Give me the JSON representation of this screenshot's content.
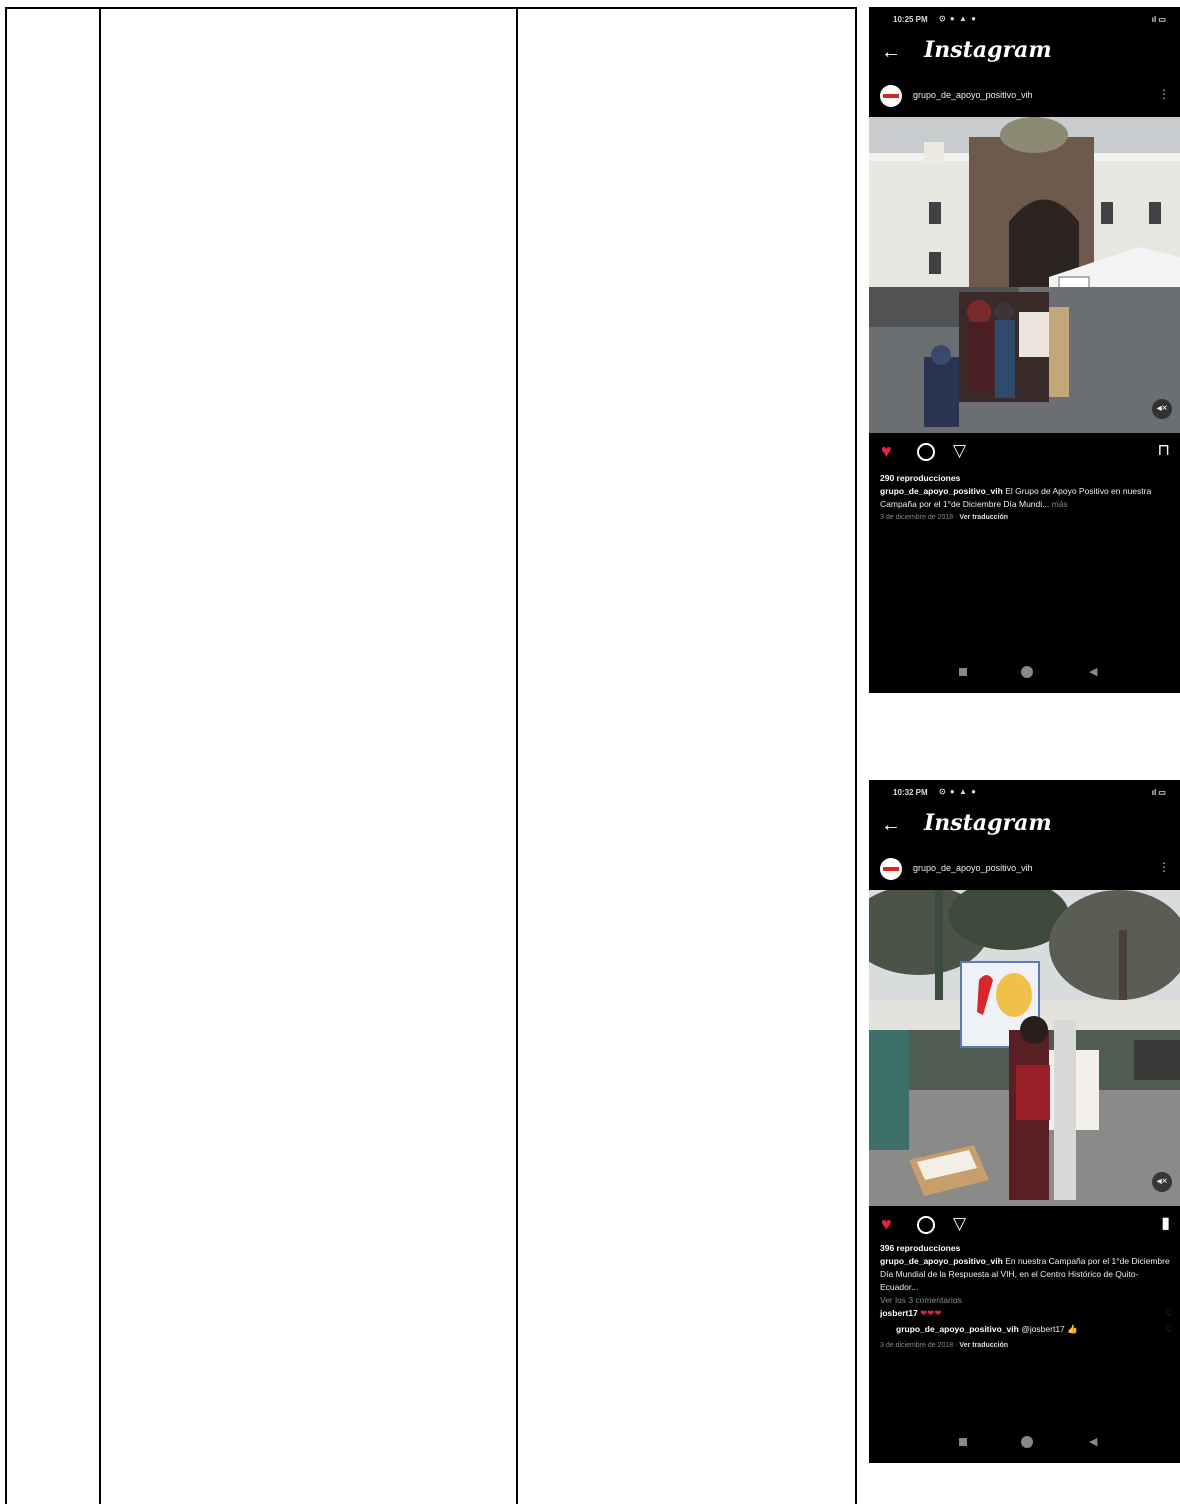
{
  "posts": [
    {
      "status": {
        "time": "10:25 PM",
        "icons": "⊙ ● ▲ ●",
        "right": "ıl ▭"
      },
      "app_title": "Instagram",
      "username": "grupo_de_apoyo_positivo_vih",
      "views": "290 reproducciones",
      "caption_user": "grupo_de_apoyo_positivo_vih",
      "caption_text": "El Grupo de Apoyo Positivo en nuestra Campaña por el 1°de Diciembre Día Mundi...",
      "more": "más",
      "date": "3 de diciembre de 2018",
      "translate": "Ver traducción"
    },
    {
      "status": {
        "time": "10:32 PM",
        "icons": "⊙ ● ▲ ●",
        "right": "ıl ▭"
      },
      "app_title": "Instagram",
      "username": "grupo_de_apoyo_positivo_vih",
      "views": "396 reproducciones",
      "caption_user": "grupo_de_apoyo_positivo_vih",
      "caption_text": "En nuestra Campaña por el 1°de Diciembre Día Mundial de la Respuesta al VIH, en el Centro Histórico de Quito-Ecuador...",
      "view_comments": "Ver los 3 comentarios",
      "comment1_user": "josbert17",
      "comment1_text": "❤❤❤",
      "comment2_user": "grupo_de_apoyo_positivo_vih",
      "comment2_text": "@josbert17 👍",
      "date": "3 de diciembre de 2018",
      "translate": "Ver traducción"
    }
  ],
  "icons": {
    "back": "arrow-left-icon",
    "heart": "heart-icon",
    "comment": "comment-icon",
    "share": "share-icon",
    "save": "bookmark-icon",
    "more": "more-vert-icon",
    "mute": "speaker-muted-icon"
  },
  "colors": {
    "like": "#e3233e",
    "background": "#000000"
  }
}
